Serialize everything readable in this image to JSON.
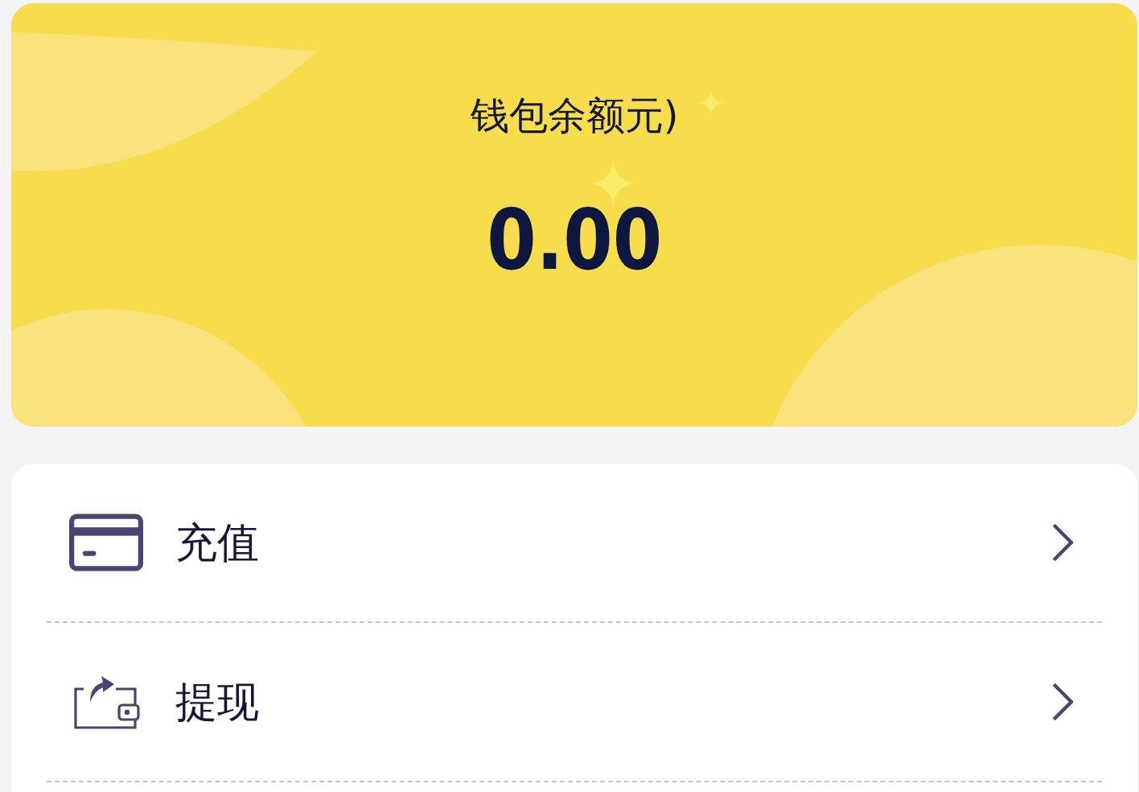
{
  "balance": {
    "label": "钱包余额元)",
    "amount": "0.00"
  },
  "menu": [
    {
      "kind": "card",
      "label": "充值"
    },
    {
      "kind": "wallet",
      "label": "提现"
    }
  ]
}
